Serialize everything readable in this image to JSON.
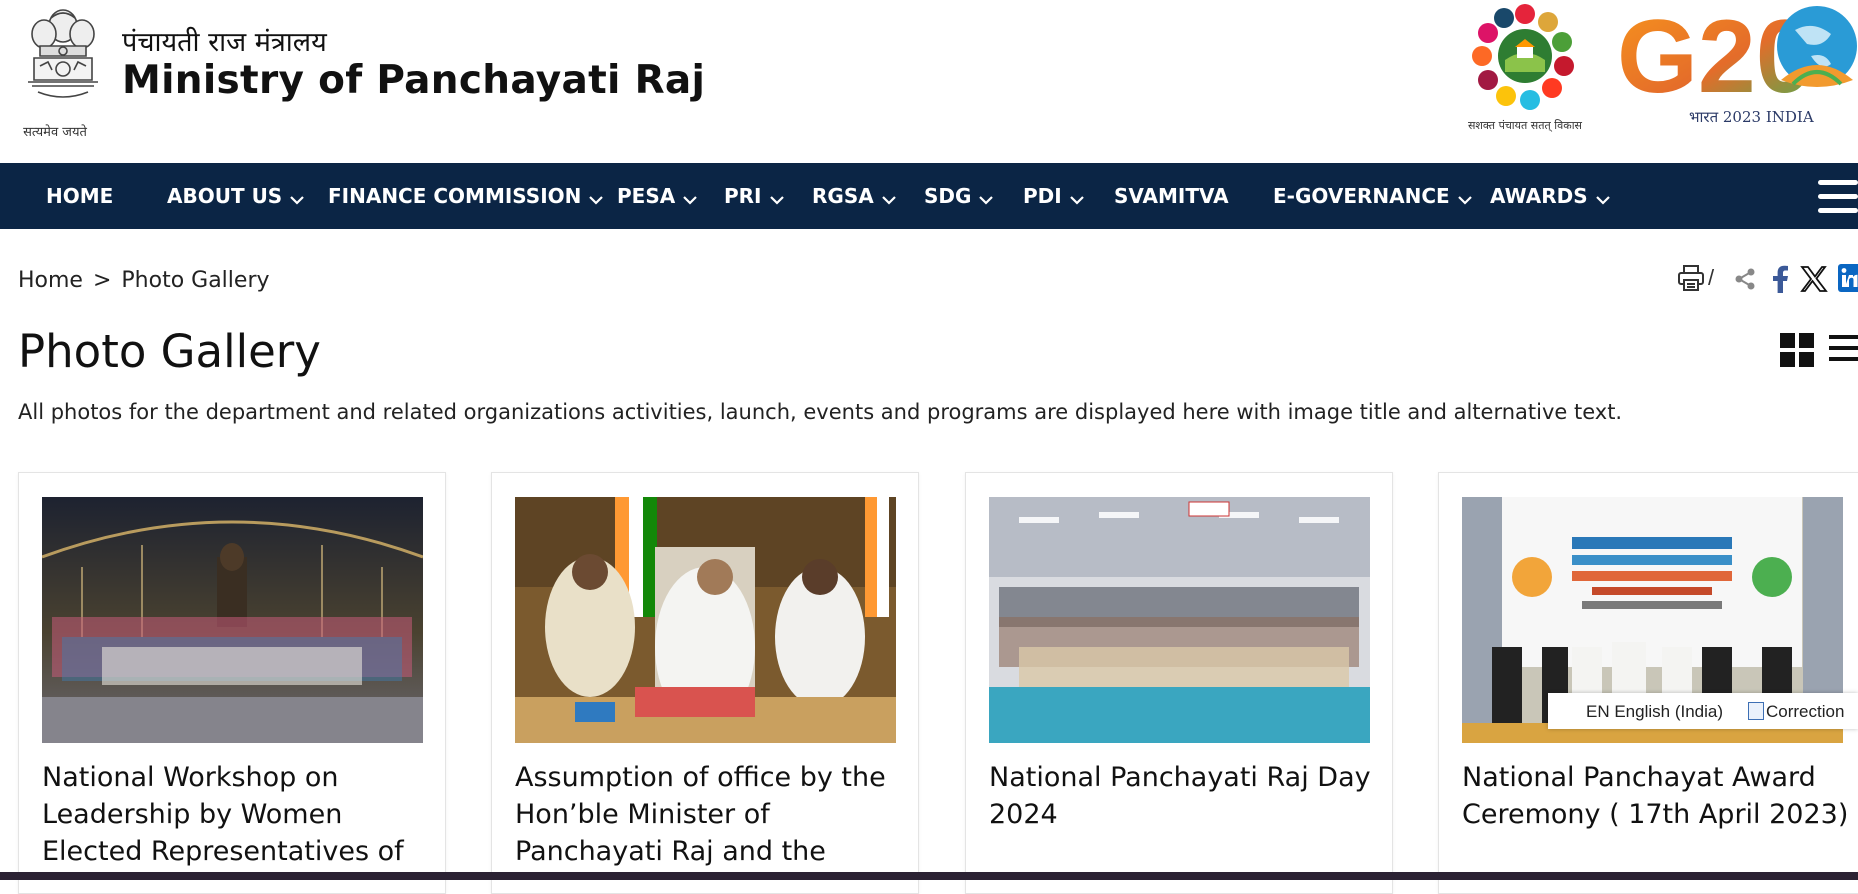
{
  "header": {
    "hindi_title": "पंचायती राज मंत्रालय",
    "title": "Ministry of Panchayati Raj",
    "emblem_motto": "सत्यमेव जयते",
    "sdg_caption": "सशक्त पंचायत सतत् विकास",
    "g20_text": "G20",
    "g20_caption": "भारत 2023 INDIA"
  },
  "nav": {
    "items": [
      {
        "label": "HOME",
        "dropdown": false
      },
      {
        "label": "ABOUT US",
        "dropdown": true
      },
      {
        "label": "FINANCE COMMISSION",
        "dropdown": true
      },
      {
        "label": "PESA",
        "dropdown": true
      },
      {
        "label": "PRI",
        "dropdown": true
      },
      {
        "label": "RGSA",
        "dropdown": true
      },
      {
        "label": "SDG",
        "dropdown": true
      },
      {
        "label": "PDI",
        "dropdown": true
      },
      {
        "label": "SVAMITVA",
        "dropdown": false
      },
      {
        "label": "E-GOVERNANCE",
        "dropdown": true
      },
      {
        "label": "AWARDS",
        "dropdown": true
      }
    ],
    "menu_icon": "hamburger-icon"
  },
  "breadcrumb": {
    "home": "Home",
    "separator": ">",
    "current": "Photo Gallery"
  },
  "tools": {
    "slash": "/",
    "icons": [
      "print-icon",
      "share-icon",
      "facebook-icon",
      "x-twitter-icon",
      "linkedin-icon"
    ]
  },
  "page": {
    "title": "Photo Gallery",
    "intro": "All photos for the department and related organizations activities, launch, events and programs are displayed here with image title and alternative text."
  },
  "view_toggles": [
    "grid-view-icon",
    "list-view-icon"
  ],
  "gallery": [
    {
      "title": "National Workshop on Leadership by Women Elected Representatives of"
    },
    {
      "title": "Assumption of office by the Hon’ble Minister of Panchayati Raj and the"
    },
    {
      "title": "National Panchayati Raj Day 2024"
    },
    {
      "title": "National Panchayat Award Ceremony ( 17th April 2023)"
    }
  ],
  "language_popup": {
    "language": "EN English (India)",
    "correction": "Correction"
  },
  "colors": {
    "nav_background": "#0b2545",
    "nav_text": "#ffffff",
    "facebook": "#3b5998",
    "linkedin": "#0a66c2"
  }
}
